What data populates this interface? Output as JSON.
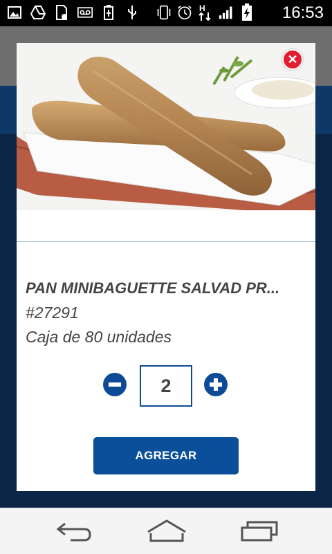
{
  "status_bar": {
    "time": "16:53",
    "left_icons": [
      "image-icon",
      "drive-icon",
      "sd-card-icon",
      "voicemail-icon",
      "battery-saver-icon",
      "usb-icon"
    ],
    "right_icons": [
      "vibrate-icon",
      "alarm-icon",
      "hspa-icon",
      "signal-icon",
      "battery-charging-icon"
    ]
  },
  "product_dialog": {
    "name": "PAN MINIBAGUETTE SALVAD PR...",
    "code": "#27291",
    "pack": "Caja de 80 unidades",
    "quantity": "2",
    "add_label": "AGREGAR"
  },
  "navbar": {
    "buttons": [
      "back-icon",
      "home-icon",
      "recent-apps-icon"
    ]
  },
  "colors": {
    "accent": "#0b4f9b",
    "close": "#e21d2f",
    "background": "#0b2546"
  }
}
